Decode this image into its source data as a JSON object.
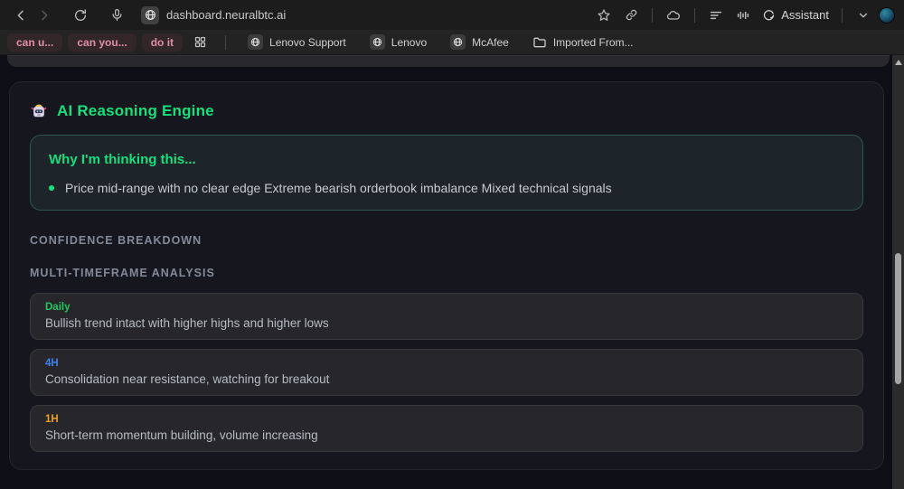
{
  "browser": {
    "url": "dashboard.neuralbtc.ai",
    "assistant_label": "Assistant",
    "icons": {
      "back": "chevron-left",
      "forward": "chevron-right",
      "reload": "refresh",
      "mic": "microphone",
      "site": "globe",
      "bookmark": "star",
      "copy_link": "link",
      "extensions": "cloud",
      "reading_list": "lines",
      "voice": "waveform",
      "assistant": "swirl",
      "menu_expand": "chevron-down",
      "profile": "globe-avatar"
    }
  },
  "bookmarks": {
    "pills": [
      {
        "label": "can u..."
      },
      {
        "label": "can you..."
      },
      {
        "label": "do it"
      }
    ],
    "items": [
      {
        "label": "Lenovo Support",
        "icon": "globe"
      },
      {
        "label": "Lenovo",
        "icon": "globe"
      },
      {
        "label": "McAfee",
        "icon": "globe"
      },
      {
        "label": "Imported From...",
        "icon": "folder"
      }
    ]
  },
  "main": {
    "title": "AI Reasoning Engine",
    "title_color": "#18df7b",
    "title_icon": "robot",
    "reasoning_box": {
      "title": "Why I'm thinking this...",
      "title_color": "#18df7b",
      "bullet_color": "#1ddf7e",
      "bullets": [
        "Price mid-range with no clear edge Extreme bearish orderbook imbalance Mixed technical signals"
      ]
    },
    "sections": [
      {
        "label": "CONFIDENCE BREAKDOWN"
      },
      {
        "label": "MULTI-TIMEFRAME ANALYSIS"
      }
    ],
    "timeframes": [
      {
        "label": "Daily",
        "color": "#22c55e",
        "text": "Bullish trend intact with higher highs and higher lows"
      },
      {
        "label": "4H",
        "color": "#3b82f6",
        "text": "Consolidation near resistance, watching for breakout"
      },
      {
        "label": "1H",
        "color": "#f0a11d",
        "text": "Short-term momentum building, volume increasing"
      }
    ]
  }
}
